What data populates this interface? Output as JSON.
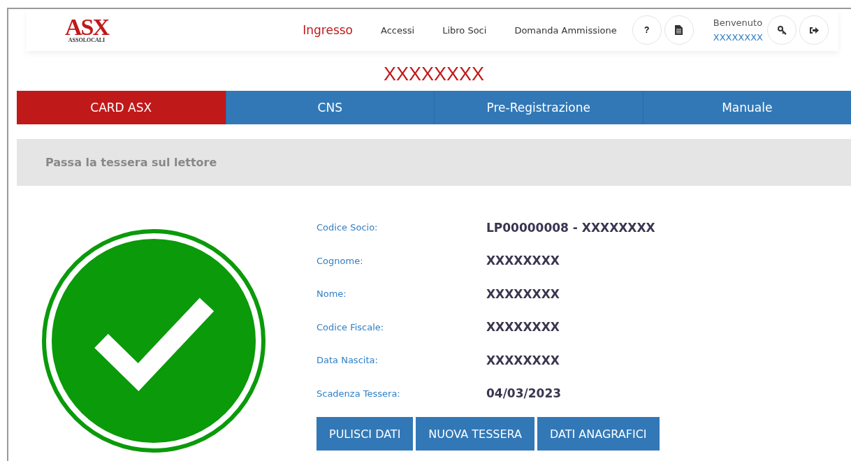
{
  "header": {
    "logo": {
      "mark": "ASX",
      "subtitle": "ASSOLOCALI"
    },
    "nav": [
      {
        "label": "Ingresso",
        "selected": true
      },
      {
        "label": "Accessi",
        "selected": false
      },
      {
        "label": "Libro Soci",
        "selected": false
      },
      {
        "label": "Domanda Ammissione",
        "selected": false
      }
    ],
    "help_button": "?",
    "welcome": {
      "label": "Benvenuto",
      "user": "XXXXXXXX"
    }
  },
  "title": "XXXXXXXX",
  "tabs": [
    {
      "label": "CARD ASX",
      "selected": true
    },
    {
      "label": "CNS",
      "selected": false
    },
    {
      "label": "Pre-Registrazione",
      "selected": false
    },
    {
      "label": "Manuale",
      "selected": false
    }
  ],
  "instruction": "Passa la tessera sul lettore",
  "fields": [
    {
      "label": "Codice Socio:",
      "value": "LP00000008 - XXXXXXXX"
    },
    {
      "label": "Cognome:",
      "value": "XXXXXXXX"
    },
    {
      "label": "Nome:",
      "value": "XXXXXXXX"
    },
    {
      "label": "Codice Fiscale:",
      "value": "XXXXXXXX"
    },
    {
      "label": "Data Nascita:",
      "value": "XXXXXXXX"
    },
    {
      "label": "Scadenza Tessera:",
      "value": "04/03/2023"
    }
  ],
  "buttons": [
    "PULISCI DATI",
    "NUOVA TESSERA",
    "DATI ANAGRAFICI"
  ]
}
